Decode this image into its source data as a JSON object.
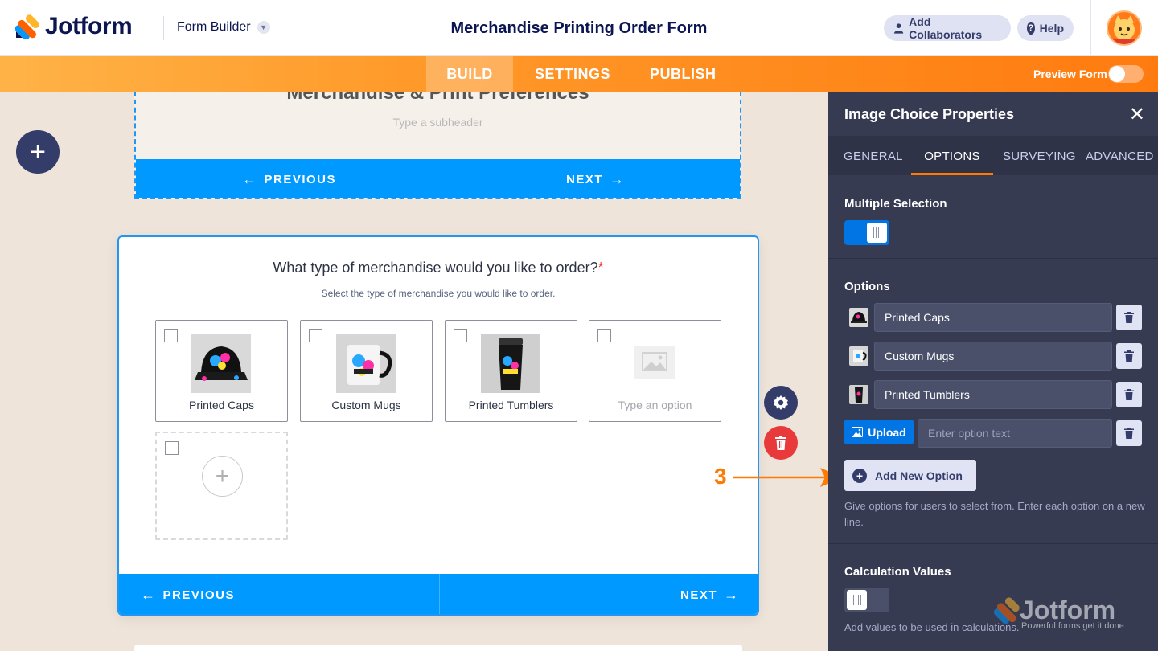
{
  "header": {
    "brand": "Jotform",
    "mode": "Form Builder",
    "form_title": "Merchandise Printing Order Form",
    "add_collaborators": "Add Collaborators",
    "help": "Help"
  },
  "nav": {
    "tabs": [
      {
        "label": "BUILD",
        "active": true
      },
      {
        "label": "SETTINGS",
        "active": false
      },
      {
        "label": "PUBLISH",
        "active": false
      }
    ],
    "preview_label": "Preview Form",
    "preview_on": false
  },
  "canvas": {
    "section_title": "Merchandise & Print Preferences",
    "subheader_placeholder": "Type a subheader",
    "previous": "PREVIOUS",
    "next": "NEXT",
    "question": "What type of merchandise would you like to order?",
    "required_mark": "*",
    "question_sub": "Select the type of merchandise you would like to order.",
    "options": [
      {
        "label": "Printed Caps"
      },
      {
        "label": "Custom Mugs"
      },
      {
        "label": "Printed Tumblers"
      },
      {
        "label": "Type an option"
      }
    ]
  },
  "annotation": {
    "step": "3"
  },
  "panel": {
    "title": "Image Choice Properties",
    "tabs": [
      {
        "label": "GENERAL",
        "active": false
      },
      {
        "label": "OPTIONS",
        "active": true
      },
      {
        "label": "SURVEYING",
        "active": false
      },
      {
        "label": "ADVANCED",
        "active": false
      }
    ],
    "multiple_selection": {
      "label": "Multiple Selection",
      "on": true
    },
    "options_title": "Options",
    "option_items": [
      "Printed Caps",
      "Custom Mugs",
      "Printed Tumblers"
    ],
    "upload_label": "Upload",
    "option_placeholder": "Enter option text",
    "add_new_option": "Add New Option",
    "options_help": "Give options for users to select from. Enter each option on a new line.",
    "calculation": {
      "label": "Calculation Values",
      "on": false,
      "help": "Add values to be used in calculations."
    },
    "watermark": {
      "brand": "Jotform",
      "tagline": "Powerful forms get it done"
    }
  },
  "colors": {
    "accent": "#ff7a00",
    "primary_blue": "#0099ff",
    "panel_bg": "#363b52",
    "brand_navy": "#0a1551"
  }
}
